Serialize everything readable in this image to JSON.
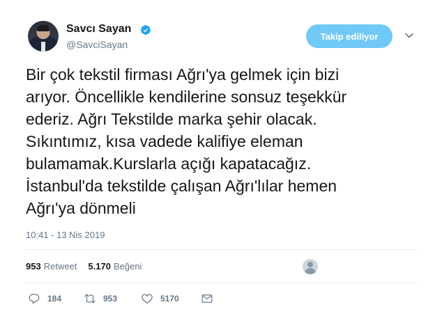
{
  "user": {
    "display_name": "Savcı Sayan",
    "handle": "@SavciSayan",
    "verified": true
  },
  "follow_button": {
    "label": "Takip ediliyor"
  },
  "tweet": {
    "lines": [
      "Bir çok tekstil firması Ağrı'ya gelmek için bizi",
      "arıyor. Öncellikle kendilerine sonsuz teşekkür",
      "ederiz. Ağrı Tekstilde marka şehir olacak.",
      "Sıkıntımız, kısa vadede kalifiye eleman",
      "bulamamak.Kurslarla açığı kapatacağız.",
      "İstanbul'da tekstilde çalışan Ağrı'lılar hemen",
      "Ağrı'ya dönmeli"
    ],
    "timestamp": "10:41 - 13 Nis 2019"
  },
  "stats": {
    "retweet_count": "953",
    "retweet_label": "Retweet",
    "like_count": "5.170",
    "like_label": "Beğeni"
  },
  "actions": {
    "reply_count": "184",
    "retweet_count": "953",
    "like_count": "5170"
  },
  "icons": {
    "verified": "verified-badge-icon",
    "caret": "chevron-down-icon",
    "reply": "reply-bubble-icon",
    "retweet": "retweet-arrows-icon",
    "like": "heart-icon",
    "message": "envelope-icon"
  },
  "colors": {
    "accent": "#1da1f2",
    "follow_button_bg": "#71c9f8",
    "secondary_text": "#657786",
    "divider": "#e6ecf0"
  }
}
